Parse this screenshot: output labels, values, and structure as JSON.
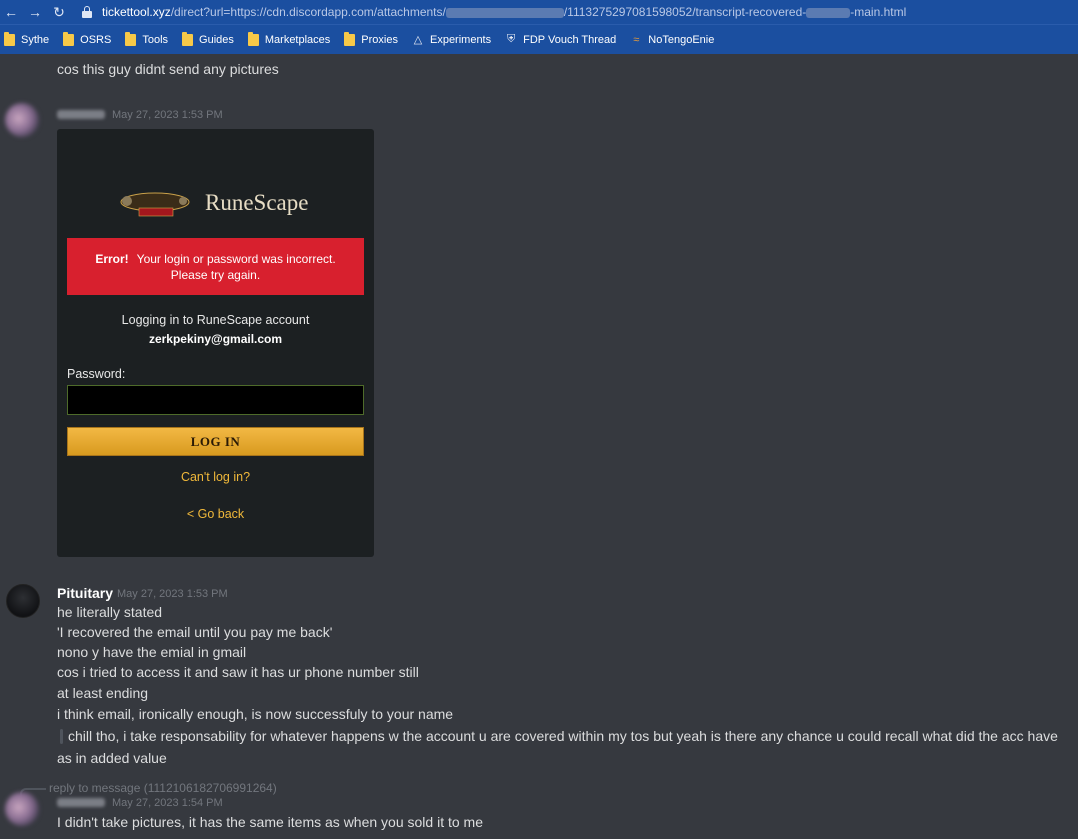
{
  "browser": {
    "url_host": "tickettool.xyz",
    "url_path_start": "/direct?url=https://cdn.discordapp.com/attachments/",
    "url_path_mid": "/1113275297081598052/transcript-recovered-",
    "url_path_end": "-main.html",
    "bookmarks": [
      "Sythe",
      "OSRS",
      "Tools",
      "Guides",
      "Marketplaces",
      "Proxies",
      "Experiments",
      "FDP Vouch Thread",
      "NoTengoEnie"
    ]
  },
  "chat": {
    "top_line": "cos this guy didnt send any pictures",
    "msg1": {
      "timestamp": "May 27, 2023 1:53 PM"
    },
    "embed": {
      "logo_text": "RuneScape",
      "error_bold": "Error!",
      "error_text": "Your login or password was incorrect.",
      "error_text2": "Please try again.",
      "login_label": "Logging in to RuneScape account",
      "email": "zerkpekiny@gmail.com",
      "password_label": "Password:",
      "login_button": "LOG IN",
      "cant_login": "Can't log in?",
      "go_back": "< Go back"
    },
    "msg2": {
      "username": "Pituitary",
      "timestamp": "May 27, 2023 1:53 PM",
      "lines": [
        "he literally stated",
        "'I recovered the email until you pay me back'",
        "nono y have the emial in gmail",
        "cos i tried to access it and saw it has ur phone number still",
        "at least ending",
        "i think email, ironically enough, is now successfuly to your name"
      ],
      "quote": "chill tho, i take responsability for whatever happens w the account u are covered within my tos but yeah is there any chance u could recall what did the acc have",
      "after_quote": "as in added value"
    },
    "msg3": {
      "reply_text": "reply to message (1112106182706991264)",
      "timestamp": "May 27, 2023 1:54 PM",
      "text": "I didn't take pictures, it has the same items as when you sold it to me"
    }
  }
}
